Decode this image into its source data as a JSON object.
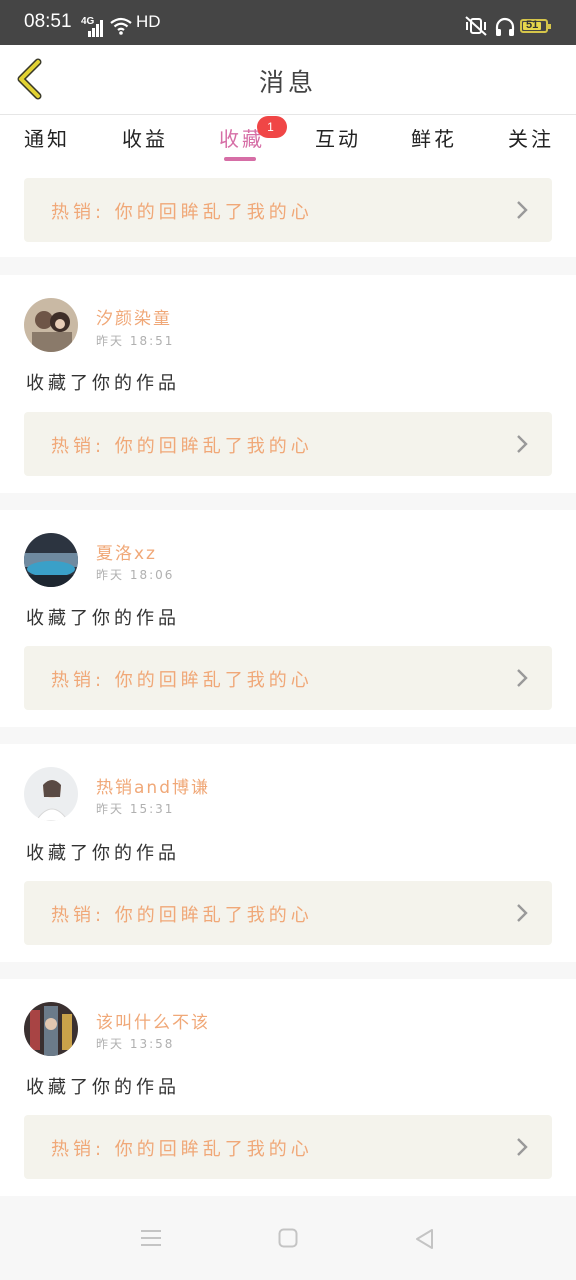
{
  "status_bar": {
    "time": "08:51",
    "network": "4G",
    "hd": "HD",
    "battery": "51"
  },
  "header": {
    "title": "消息",
    "back_icon": "chevron-left-icon",
    "back_color": "#e2d233"
  },
  "tabs": [
    {
      "label": "通知"
    },
    {
      "label": "收益"
    },
    {
      "label": "收藏",
      "active": true,
      "badge": "1"
    },
    {
      "label": "互动"
    },
    {
      "label": "鲜花"
    },
    {
      "label": "关注"
    }
  ],
  "accent_color": "#d66ea6",
  "top_link": {
    "text": "热销:  你的回眸乱了我的心"
  },
  "messages": [
    {
      "username": "汐颜染童",
      "time": "昨天  18:51",
      "action": "收藏了你的作品",
      "link": "热销:  你的回眸乱了我的心"
    },
    {
      "username": "夏洛xz",
      "time": "昨天  18:06",
      "action": "收藏了你的作品",
      "link": "热销:  你的回眸乱了我的心"
    },
    {
      "username": "热销and博谦",
      "time": "昨天  15:31",
      "action": "收藏了你的作品",
      "link": "热销:  你的回眸乱了我的心"
    },
    {
      "username": "该叫什么不该",
      "time": "昨天  13:58",
      "action": "收藏了你的作品",
      "link": "热销:  你的回眸乱了我的心"
    }
  ],
  "nav_icons": [
    "menu-icon",
    "home-square-icon",
    "back-triangle-icon"
  ]
}
